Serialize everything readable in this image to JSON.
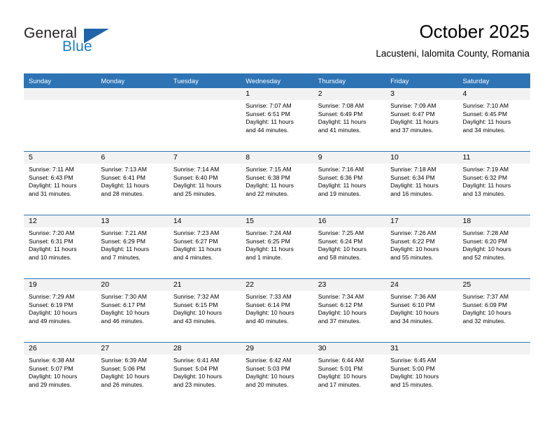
{
  "brand": {
    "name_part1": "General",
    "name_part2": "Blue",
    "accent_color": "#1f64a8",
    "blue_text_color": "#1a7fc1"
  },
  "header": {
    "title": "October 2025",
    "subtitle": "Lacusteni, Ialomita County, Romania",
    "header_row_color": "#2e74b5",
    "daynum_strip_color": "#f2f2f2"
  },
  "weekday_headers": [
    "Sunday",
    "Monday",
    "Tuesday",
    "Wednesday",
    "Thursday",
    "Friday",
    "Saturday"
  ],
  "weeks": [
    [
      {
        "day": "",
        "empty": true
      },
      {
        "day": "",
        "empty": true
      },
      {
        "day": "",
        "empty": true
      },
      {
        "day": "1",
        "sunrise": "Sunrise: 7:07 AM",
        "sunset": "Sunset: 6:51 PM",
        "daylight_line1": "Daylight: 11 hours",
        "daylight_line2": "and 44 minutes."
      },
      {
        "day": "2",
        "sunrise": "Sunrise: 7:08 AM",
        "sunset": "Sunset: 6:49 PM",
        "daylight_line1": "Daylight: 11 hours",
        "daylight_line2": "and 41 minutes."
      },
      {
        "day": "3",
        "sunrise": "Sunrise: 7:09 AM",
        "sunset": "Sunset: 6:47 PM",
        "daylight_line1": "Daylight: 11 hours",
        "daylight_line2": "and 37 minutes."
      },
      {
        "day": "4",
        "sunrise": "Sunrise: 7:10 AM",
        "sunset": "Sunset: 6:45 PM",
        "daylight_line1": "Daylight: 11 hours",
        "daylight_line2": "and 34 minutes."
      }
    ],
    [
      {
        "day": "5",
        "sunrise": "Sunrise: 7:11 AM",
        "sunset": "Sunset: 6:43 PM",
        "daylight_line1": "Daylight: 11 hours",
        "daylight_line2": "and 31 minutes."
      },
      {
        "day": "6",
        "sunrise": "Sunrise: 7:13 AM",
        "sunset": "Sunset: 6:41 PM",
        "daylight_line1": "Daylight: 11 hours",
        "daylight_line2": "and 28 minutes."
      },
      {
        "day": "7",
        "sunrise": "Sunrise: 7:14 AM",
        "sunset": "Sunset: 6:40 PM",
        "daylight_line1": "Daylight: 11 hours",
        "daylight_line2": "and 25 minutes."
      },
      {
        "day": "8",
        "sunrise": "Sunrise: 7:15 AM",
        "sunset": "Sunset: 6:38 PM",
        "daylight_line1": "Daylight: 11 hours",
        "daylight_line2": "and 22 minutes."
      },
      {
        "day": "9",
        "sunrise": "Sunrise: 7:16 AM",
        "sunset": "Sunset: 6:36 PM",
        "daylight_line1": "Daylight: 11 hours",
        "daylight_line2": "and 19 minutes."
      },
      {
        "day": "10",
        "sunrise": "Sunrise: 7:18 AM",
        "sunset": "Sunset: 6:34 PM",
        "daylight_line1": "Daylight: 11 hours",
        "daylight_line2": "and 16 minutes."
      },
      {
        "day": "11",
        "sunrise": "Sunrise: 7:19 AM",
        "sunset": "Sunset: 6:32 PM",
        "daylight_line1": "Daylight: 11 hours",
        "daylight_line2": "and 13 minutes."
      }
    ],
    [
      {
        "day": "12",
        "sunrise": "Sunrise: 7:20 AM",
        "sunset": "Sunset: 6:31 PM",
        "daylight_line1": "Daylight: 11 hours",
        "daylight_line2": "and 10 minutes."
      },
      {
        "day": "13",
        "sunrise": "Sunrise: 7:21 AM",
        "sunset": "Sunset: 6:29 PM",
        "daylight_line1": "Daylight: 11 hours",
        "daylight_line2": "and 7 minutes."
      },
      {
        "day": "14",
        "sunrise": "Sunrise: 7:23 AM",
        "sunset": "Sunset: 6:27 PM",
        "daylight_line1": "Daylight: 11 hours",
        "daylight_line2": "and 4 minutes."
      },
      {
        "day": "15",
        "sunrise": "Sunrise: 7:24 AM",
        "sunset": "Sunset: 6:25 PM",
        "daylight_line1": "Daylight: 11 hours",
        "daylight_line2": "and 1 minute."
      },
      {
        "day": "16",
        "sunrise": "Sunrise: 7:25 AM",
        "sunset": "Sunset: 6:24 PM",
        "daylight_line1": "Daylight: 10 hours",
        "daylight_line2": "and 58 minutes."
      },
      {
        "day": "17",
        "sunrise": "Sunrise: 7:26 AM",
        "sunset": "Sunset: 6:22 PM",
        "daylight_line1": "Daylight: 10 hours",
        "daylight_line2": "and 55 minutes."
      },
      {
        "day": "18",
        "sunrise": "Sunrise: 7:28 AM",
        "sunset": "Sunset: 6:20 PM",
        "daylight_line1": "Daylight: 10 hours",
        "daylight_line2": "and 52 minutes."
      }
    ],
    [
      {
        "day": "19",
        "sunrise": "Sunrise: 7:29 AM",
        "sunset": "Sunset: 6:19 PM",
        "daylight_line1": "Daylight: 10 hours",
        "daylight_line2": "and 49 minutes."
      },
      {
        "day": "20",
        "sunrise": "Sunrise: 7:30 AM",
        "sunset": "Sunset: 6:17 PM",
        "daylight_line1": "Daylight: 10 hours",
        "daylight_line2": "and 46 minutes."
      },
      {
        "day": "21",
        "sunrise": "Sunrise: 7:32 AM",
        "sunset": "Sunset: 6:15 PM",
        "daylight_line1": "Daylight: 10 hours",
        "daylight_line2": "and 43 minutes."
      },
      {
        "day": "22",
        "sunrise": "Sunrise: 7:33 AM",
        "sunset": "Sunset: 6:14 PM",
        "daylight_line1": "Daylight: 10 hours",
        "daylight_line2": "and 40 minutes."
      },
      {
        "day": "23",
        "sunrise": "Sunrise: 7:34 AM",
        "sunset": "Sunset: 6:12 PM",
        "daylight_line1": "Daylight: 10 hours",
        "daylight_line2": "and 37 minutes."
      },
      {
        "day": "24",
        "sunrise": "Sunrise: 7:36 AM",
        "sunset": "Sunset: 6:10 PM",
        "daylight_line1": "Daylight: 10 hours",
        "daylight_line2": "and 34 minutes."
      },
      {
        "day": "25",
        "sunrise": "Sunrise: 7:37 AM",
        "sunset": "Sunset: 6:09 PM",
        "daylight_line1": "Daylight: 10 hours",
        "daylight_line2": "and 32 minutes."
      }
    ],
    [
      {
        "day": "26",
        "sunrise": "Sunrise: 6:38 AM",
        "sunset": "Sunset: 5:07 PM",
        "daylight_line1": "Daylight: 10 hours",
        "daylight_line2": "and 29 minutes."
      },
      {
        "day": "27",
        "sunrise": "Sunrise: 6:39 AM",
        "sunset": "Sunset: 5:06 PM",
        "daylight_line1": "Daylight: 10 hours",
        "daylight_line2": "and 26 minutes."
      },
      {
        "day": "28",
        "sunrise": "Sunrise: 6:41 AM",
        "sunset": "Sunset: 5:04 PM",
        "daylight_line1": "Daylight: 10 hours",
        "daylight_line2": "and 23 minutes."
      },
      {
        "day": "29",
        "sunrise": "Sunrise: 6:42 AM",
        "sunset": "Sunset: 5:03 PM",
        "daylight_line1": "Daylight: 10 hours",
        "daylight_line2": "and 20 minutes."
      },
      {
        "day": "30",
        "sunrise": "Sunrise: 6:44 AM",
        "sunset": "Sunset: 5:01 PM",
        "daylight_line1": "Daylight: 10 hours",
        "daylight_line2": "and 17 minutes."
      },
      {
        "day": "31",
        "sunrise": "Sunrise: 6:45 AM",
        "sunset": "Sunset: 5:00 PM",
        "daylight_line1": "Daylight: 10 hours",
        "daylight_line2": "and 15 minutes."
      },
      {
        "day": "",
        "empty": true
      }
    ]
  ]
}
